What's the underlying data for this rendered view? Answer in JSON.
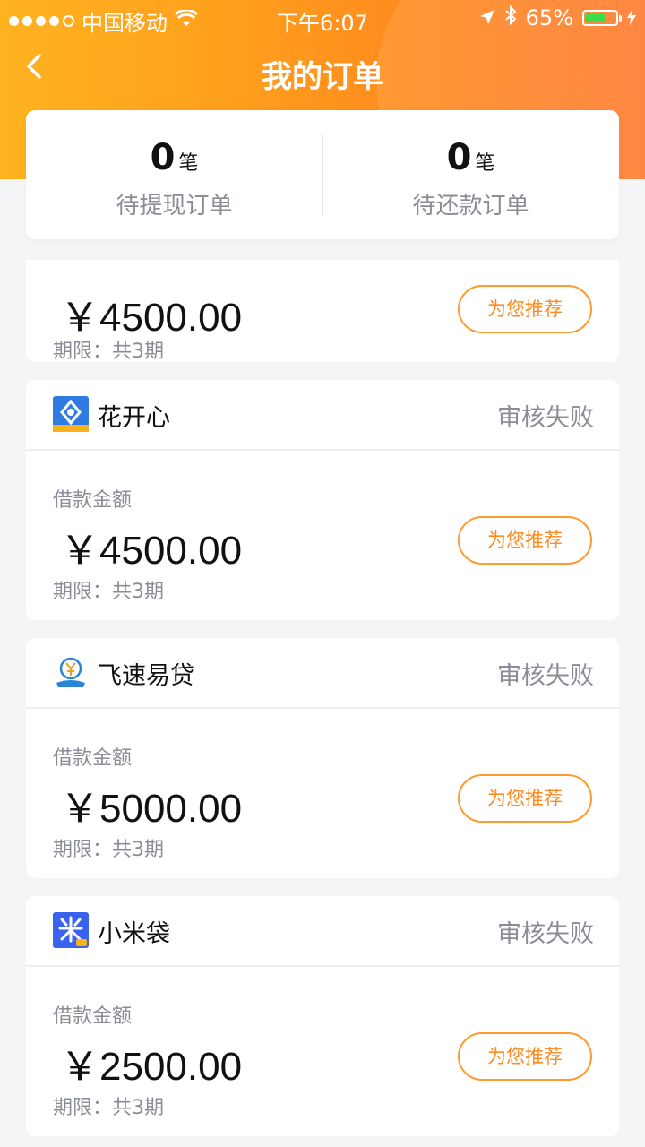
{
  "status_bar": {
    "carrier": "中国移动",
    "time": "下午6:07",
    "battery": "65%",
    "battery_level": 0.65
  },
  "nav": {
    "title": "我的订单",
    "back_icon": "chevron-left-icon"
  },
  "summary": {
    "pending_withdraw": {
      "count": "0",
      "unit": "笔",
      "label": "待提现订单"
    },
    "pending_repay": {
      "count": "0",
      "unit": "笔",
      "label": "待还款订单"
    }
  },
  "partial_order": {
    "amount": "￥4500.00",
    "term": "期限：共3期",
    "button": "为您推荐"
  },
  "orders": [
    {
      "lender": "花开心",
      "status": "审核失败",
      "amount_label": "借款金额",
      "amount": "￥4500.00",
      "term": "期限：共3期",
      "button": "为您推荐",
      "logo_color": "#2d7be3"
    },
    {
      "lender": "飞速易贷",
      "status": "审核失败",
      "amount_label": "借款金额",
      "amount": "￥5000.00",
      "term": "期限：共3期",
      "button": "为您推荐",
      "logo_color": "#2a84d8"
    },
    {
      "lender": "小米袋",
      "status": "审核失败",
      "amount_label": "借款金额",
      "amount": "￥2500.00",
      "term": "期限：共3期",
      "button": "为您推荐",
      "logo_color": "#3a62f0"
    }
  ]
}
